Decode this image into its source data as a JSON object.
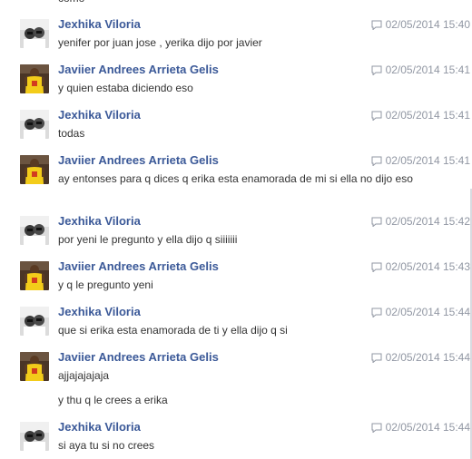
{
  "thread": {
    "cutoff_text": "como",
    "messages": [
      {
        "sender": "Jexhika Viloria",
        "avatar": "jexhika",
        "timestamp": "02/05/2014 15:40",
        "lines": [
          "yenifer por juan jose , yerika  dijo por javier"
        ]
      },
      {
        "sender": "Javiier Andrees Arrieta Gelis",
        "avatar": "javiier",
        "timestamp": "02/05/2014 15:41",
        "lines": [
          "y quien estaba diciendo eso"
        ]
      },
      {
        "sender": "Jexhika Viloria",
        "avatar": "jexhika",
        "timestamp": "02/05/2014 15:41",
        "lines": [
          "todas"
        ]
      },
      {
        "sender": "Javiier Andrees Arrieta Gelis",
        "avatar": "javiier",
        "timestamp": "02/05/2014 15:41",
        "lines": [
          "ay entonses para q dices q erika esta enamorada de mi si ella no dijo eso"
        ]
      },
      {
        "sender": "Jexhika Viloria",
        "avatar": "jexhika",
        "timestamp": "02/05/2014 15:42",
        "lines": [
          "por yeni le pregunto y ella dijo q siiiiiii"
        ]
      },
      {
        "sender": "Javiier Andrees Arrieta Gelis",
        "avatar": "javiier",
        "timestamp": "02/05/2014 15:43",
        "lines": [
          "y q le pregunto yeni"
        ]
      },
      {
        "sender": "Jexhika Viloria",
        "avatar": "jexhika",
        "timestamp": "02/05/2014 15:44",
        "lines": [
          "que si erika esta enamorada de ti y ella dijo q si"
        ]
      },
      {
        "sender": "Javiier Andrees Arrieta Gelis",
        "avatar": "javiier",
        "timestamp": "02/05/2014 15:44",
        "lines": [
          "ajjajajajaja",
          "y thu q le crees a erika"
        ]
      },
      {
        "sender": "Jexhika Viloria",
        "avatar": "jexhika",
        "timestamp": "02/05/2014 15:44",
        "lines": [
          "si aya tu si no crees"
        ]
      }
    ]
  },
  "colors": {
    "sender_name": "#3b5998",
    "timestamp": "#9197a3",
    "message_text": "#333333"
  },
  "icons": {
    "timestamp_icon": "chat-bubble-icon"
  }
}
